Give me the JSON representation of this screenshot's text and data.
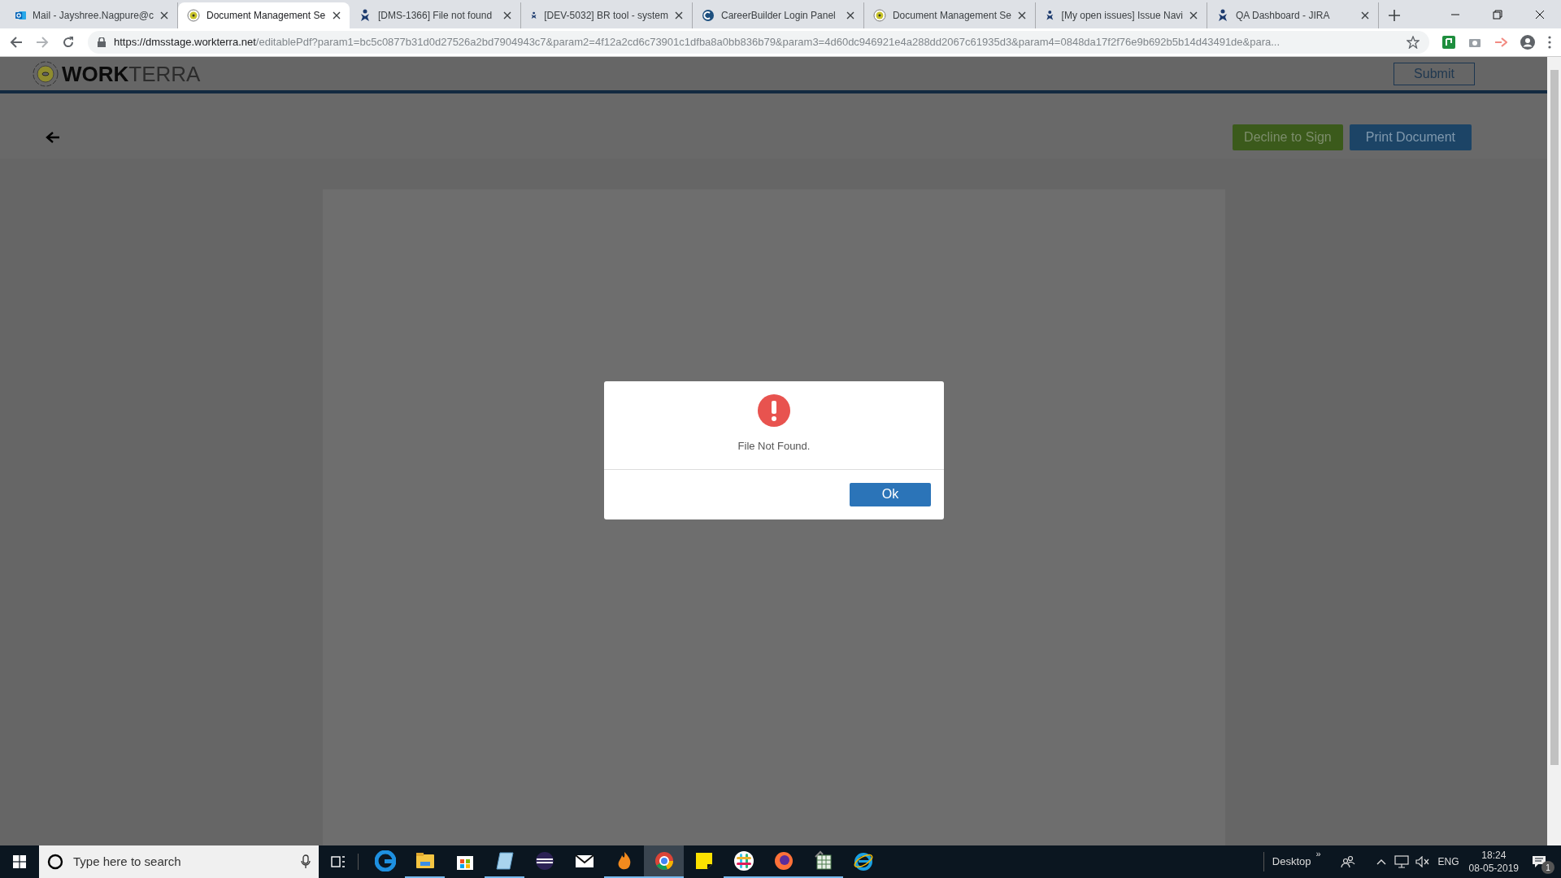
{
  "browser": {
    "tabs": [
      {
        "kind": "mail",
        "title": "Mail - Jayshree.Nagpure@c",
        "selected": false
      },
      {
        "kind": "dms",
        "title": "Document Management Se",
        "selected": true
      },
      {
        "kind": "jira",
        "title": "[DMS-1366] File not found",
        "selected": false
      },
      {
        "kind": "jira",
        "title": "[DEV-5032] BR tool - system",
        "selected": false
      },
      {
        "kind": "careerbuilder",
        "title": "CareerBuilder Login Panel",
        "selected": false
      },
      {
        "kind": "dms",
        "title": "Document Management Se",
        "selected": false
      },
      {
        "kind": "jira",
        "title": "[My open issues] Issue Navi",
        "selected": false
      },
      {
        "kind": "jira",
        "title": "QA Dashboard - JIRA",
        "selected": false
      }
    ],
    "url": {
      "host": "https://dmsstage.workterra.net",
      "path": "/editablePdf?param1=bc5c0877b31d0d27526a2bd7904943c7&param2=4f12a2cd6c73901c1dfba8a0bb836b79&param3=4d60dc946921e4a288dd2067c61935d3&param4=0848da17f2f76e9b692b5b14d43491de&para..."
    }
  },
  "header": {
    "logo": {
      "bold": "WORK",
      "light": "TERRA"
    },
    "submit": "Submit"
  },
  "toolbar": {
    "decline": "Decline to Sign",
    "print": "Print Document"
  },
  "dialog": {
    "message": "File Not Found.",
    "ok": "Ok"
  },
  "taskbar": {
    "search_placeholder": "Type here to search",
    "apps": [
      {
        "kind": "edge",
        "running": false,
        "selected": false
      },
      {
        "kind": "folder",
        "running": true,
        "selected": false
      },
      {
        "kind": "store",
        "running": false,
        "selected": false
      },
      {
        "kind": "notepad",
        "running": true,
        "selected": false
      },
      {
        "kind": "eclipse",
        "running": false,
        "selected": false
      },
      {
        "kind": "mail",
        "running": false,
        "selected": false
      },
      {
        "kind": "flame",
        "running": true,
        "selected": false
      },
      {
        "kind": "chrome",
        "running": true,
        "selected": true
      },
      {
        "kind": "sticky",
        "running": false,
        "selected": false
      },
      {
        "kind": "slack",
        "running": true,
        "selected": false
      },
      {
        "kind": "firefox",
        "running": true,
        "selected": false
      },
      {
        "kind": "sheet",
        "running": true,
        "selected": false
      },
      {
        "kind": "ie",
        "running": false,
        "selected": false
      }
    ],
    "desktop": "Desktop",
    "chevrons": "»",
    "language": "ENG",
    "time": "18:24",
    "date": "08-05-2019",
    "notifications": "1"
  }
}
